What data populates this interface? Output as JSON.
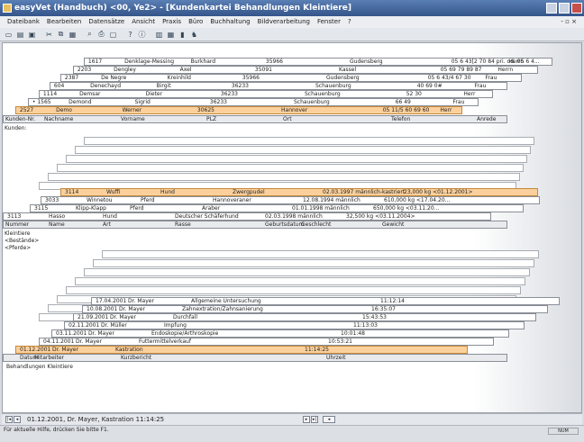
{
  "title": "easyVet (Handbuch) <00, Ye2> - [Kundenkartei Behandlungen Kleintiere]",
  "menu": [
    "Dateibank",
    "Bearbeiten",
    "Datensätze",
    "Ansicht",
    "Praxis",
    "Büro",
    "Buchhaltung",
    "Bildverarbeitung",
    "Fenster",
    "?"
  ],
  "mdi_controls": "- ▫ ×",
  "toolbar_icons": [
    "new-icon",
    "open-icon",
    "save-icon",
    "cut-icon",
    "copy-icon",
    "paste-icon",
    "find-icon",
    "print-icon",
    "preview-icon",
    "help-icon",
    "info-icon",
    "window-icon",
    "tile-icon",
    "stats-icon",
    "pet-icon"
  ],
  "customers": [
    [
      "1617",
      "Denklage-Messing",
      "Burkhard",
      "35966",
      "Gudensberg",
      "05 6 43[2 70 84 pri. od. 05 6 4...",
      "Herrn"
    ],
    [
      "2203",
      "Dengley",
      "Axel",
      "35091",
      "Kassel",
      "05 69 79 89 87",
      "Herrn"
    ],
    [
      "2387",
      "De Negre",
      "Kreinhild",
      "35966",
      "Gudensberg",
      "05 6 43/4 67 30",
      "Frau"
    ],
    [
      "604",
      "Denechayd",
      "Birgit",
      "36233",
      "Schauenburg",
      "40 69 0#",
      "Frau"
    ],
    [
      "1114",
      "Demsar",
      "Dieter",
      "36233",
      "Schauenburg",
      "52 30",
      "Herr"
    ],
    [
      "• 1565",
      "Demond",
      "Sigrid",
      "36233",
      "Schauenburg",
      "66 49",
      "Frau"
    ],
    [
      "2527",
      "Demo",
      "Werner",
      "30625",
      "Hannover",
      "05 11/5 60 69 60",
      "Herr"
    ]
  ],
  "customer_headers": [
    "Kunden-Nr.",
    "Nachname",
    "Vorname",
    "PLZ",
    "Ort",
    "Telefon",
    "Anrede"
  ],
  "customer_section": "Kunden:",
  "animals": [
    [
      "3114",
      "Wuffi",
      "Hund",
      "Zwergpudel",
      "02.03.1997 männlich-kastriert",
      "23,000 kg <01.12.2001>"
    ],
    [
      "3033",
      "Winnetou",
      "Pferd",
      "Hannoveraner",
      "12.08.1994 männlich",
      "610,000 kg <17.04.20..."
    ],
    [
      "3115",
      "Klipp-Klapp",
      "Pferd",
      "Araber",
      "01.01.1998 männlich",
      "650,000 kg <03.11.20..."
    ],
    [
      "3113",
      "Hasso",
      "Hund",
      "Deutscher Schäferhund",
      "02.03.1998 männlich",
      "32,500 kg <03.11.2004>"
    ]
  ],
  "animal_headers": [
    "Nummer",
    "Name",
    "Art",
    "Rasse",
    "Geburtsdatum",
    "Geschlecht",
    "Gewicht"
  ],
  "animal_section": "Kleintiere\n<Bestände>\n<Pferde>",
  "treatments": [
    [
      "17.04.2001",
      "Dr. Mayer",
      "Allgemeine Untersuchung",
      "11:12:14"
    ],
    [
      "10.08.2001",
      "Dr. Mayer",
      "Zahnextration/Zahnsanierung",
      "16:35:07"
    ],
    [
      "21.09.2001",
      "Dr. Mayer",
      "Durchfall",
      "15:43:53"
    ],
    [
      "02.11.2001",
      "Dr. Müller",
      "Impfung",
      "11:13:03"
    ],
    [
      "03.11.2001",
      "Dr. Mayer",
      "Endoskopie/Arthroskopie",
      "10:01:48"
    ],
    [
      "04.11.2001",
      "Dr. Mayer",
      "Futtermittelverkauf",
      "10:53:21"
    ],
    [
      "01.12.2001",
      "Dr. Mayer",
      "Kastration",
      "11:14:25"
    ]
  ],
  "treatment_headers": [
    "Datum",
    "Mitarbeiter",
    "Kurzbericht",
    "Uhrzeit"
  ],
  "treatment_section": "Behandlungen Kleintiere",
  "record_status": "01.12.2001, Dr. Mayer, Kastration 11:14:25",
  "status_text": "Für aktuelle Hilfe, drücken Sie bitte F1.",
  "num_indicator": "NUM"
}
